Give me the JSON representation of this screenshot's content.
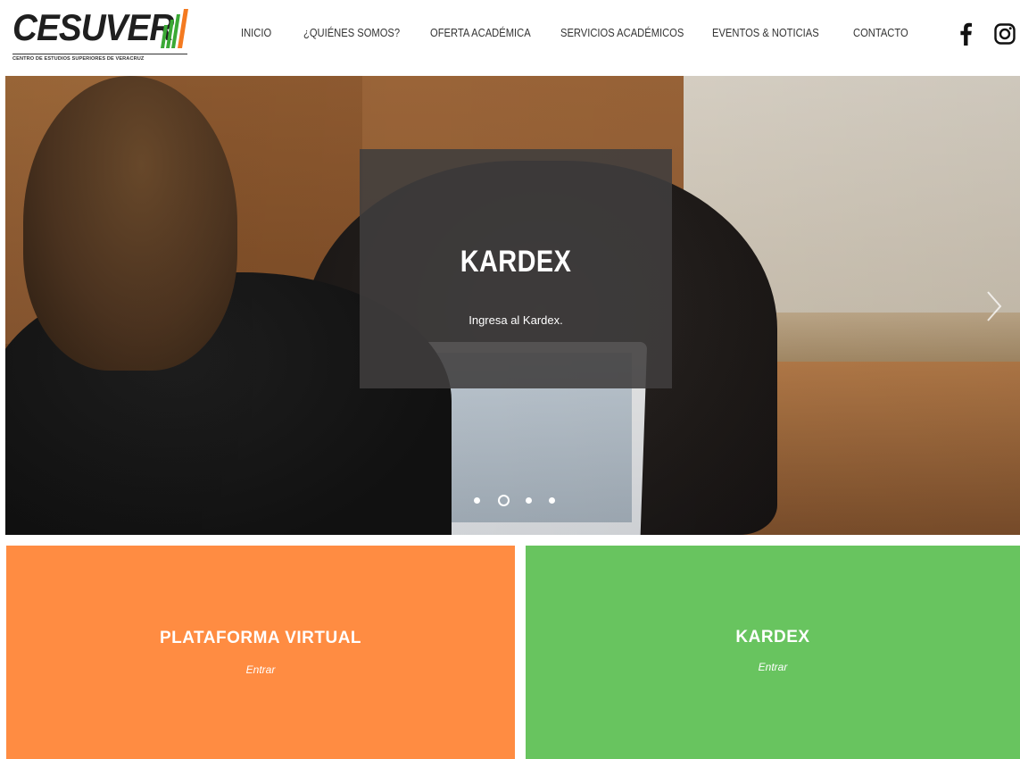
{
  "brand": {
    "name": "CESUVER",
    "tagline": "CENTRO DE ESTUDIOS SUPERIORES DE VERACRUZ"
  },
  "nav": {
    "items": [
      {
        "label": "INICIO"
      },
      {
        "label": "¿QUIÉNES SOMOS?"
      },
      {
        "label": "OFERTA ACADÉMICA"
      },
      {
        "label": "SERVICIOS ACADÉMICOS"
      },
      {
        "label": "EVENTOS & NOTICIAS"
      },
      {
        "label": "CONTACTO"
      }
    ]
  },
  "social": {
    "facebook_icon": "facebook-icon",
    "instagram_icon": "instagram-icon"
  },
  "hero": {
    "title": "KARDEX",
    "subtitle": "Ingresa al Kardex.",
    "next_icon": "chevron-right-icon",
    "slides_count": 4,
    "active_slide": 2
  },
  "cards": [
    {
      "title": "PLATAFORMA VIRTUAL",
      "link": "Entrar",
      "color": "#ff8c42"
    },
    {
      "title": "KARDEX",
      "link": "Entrar",
      "color": "#68c45f"
    }
  ],
  "colors": {
    "logo_stripe_green": "#3aa935",
    "logo_stripe_orange": "#f47a20",
    "overlay": "#403e3d"
  }
}
